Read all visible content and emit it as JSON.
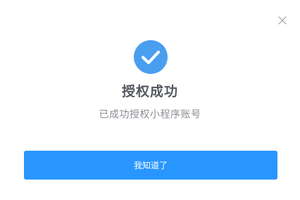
{
  "dialog": {
    "close_icon": "close-icon",
    "status_icon": "check-circle-icon",
    "title": "授权成功",
    "message": "已成功授权小程序账号",
    "confirm_label": "我知道了"
  },
  "colors": {
    "accent": "#2996ff",
    "icon_circle": "#4a9ef0",
    "title_text": "#555a61",
    "message_text": "#8a8d93",
    "close_icon": "#9a9ea5"
  }
}
